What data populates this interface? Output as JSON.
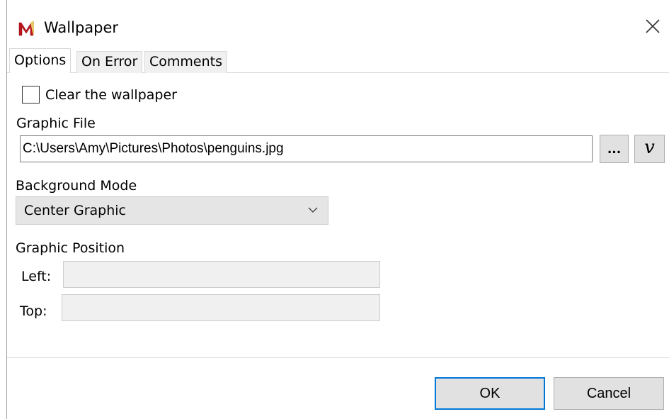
{
  "window": {
    "title": "Wallpaper",
    "app_icon": "M"
  },
  "tabs": [
    {
      "label": "Options",
      "active": true
    },
    {
      "label": "On Error",
      "active": false
    },
    {
      "label": "Comments",
      "active": false
    }
  ],
  "options": {
    "clear_checkbox": {
      "label": "Clear the wallpaper",
      "checked": false
    },
    "graphic_file": {
      "label": "Graphic File",
      "value": "C:\\Users\\Amy\\Pictures\\Photos\\penguins.jpg",
      "browse_label": "...",
      "variable_label": "v"
    },
    "background_mode": {
      "label": "Background Mode",
      "selected": "Center Graphic"
    },
    "graphic_position": {
      "label": "Graphic Position",
      "left_label": "Left:",
      "left_value": "",
      "top_label": "Top:",
      "top_value": ""
    }
  },
  "footer": {
    "ok_label": "OK",
    "cancel_label": "Cancel"
  },
  "colors": {
    "accent": "#0078d7",
    "icon_red": "#c0141b"
  }
}
